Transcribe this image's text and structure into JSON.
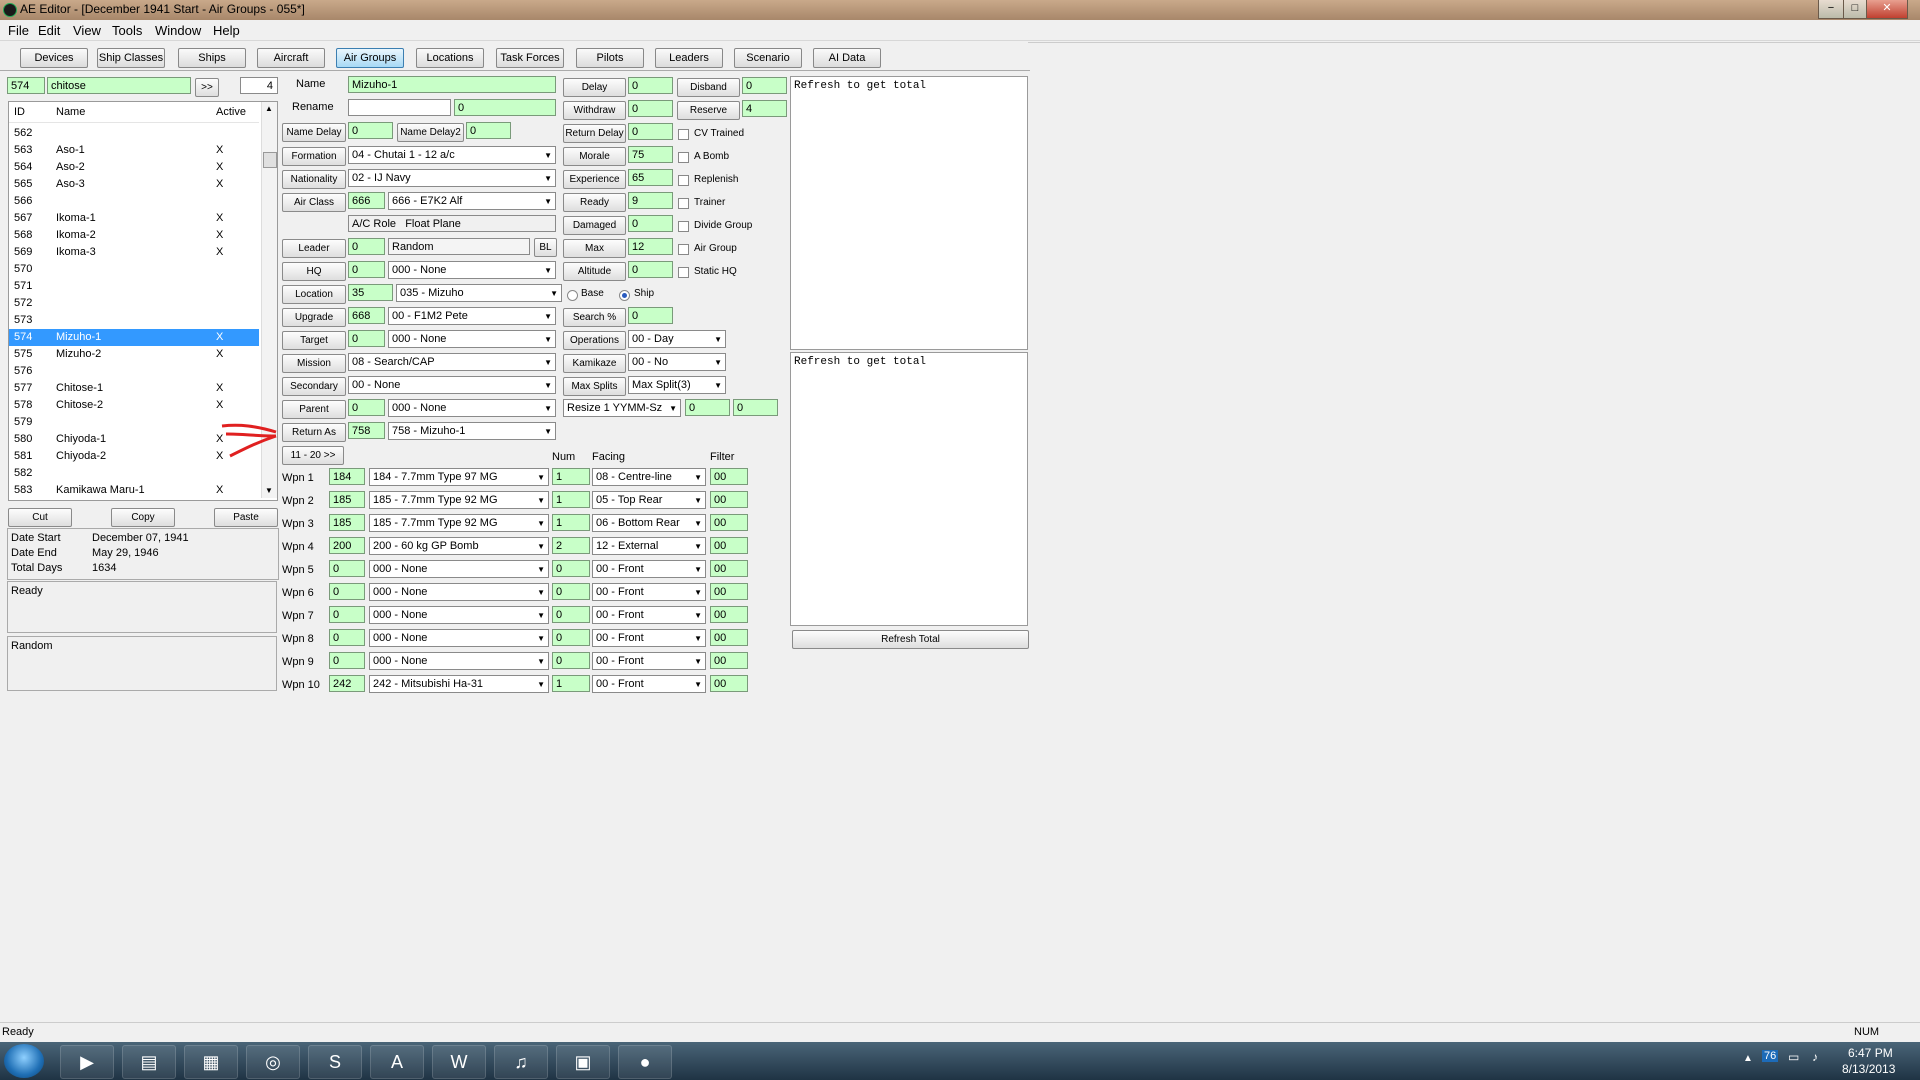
{
  "window": {
    "title": "AE Editor - [December 1941 Start - Air Groups - 055*]",
    "controls": [
      "−",
      "□",
      "✕"
    ]
  },
  "menu": [
    "File",
    "Edit",
    "View",
    "Tools",
    "Window",
    "Help"
  ],
  "tabs": [
    "Devices",
    "Ship Classes",
    "Ships",
    "Aircraft",
    "Air Groups",
    "Locations",
    "Task Forces",
    "Pilots",
    "Leaders",
    "Scenario",
    "AI Data"
  ],
  "search": {
    "id": "574",
    "text": "chitose",
    "go_label": ">>",
    "count": "4"
  },
  "list": {
    "headers": [
      "ID",
      "Name",
      "Active"
    ],
    "rows": [
      {
        "id": "562",
        "name": "",
        "active": ""
      },
      {
        "id": "563",
        "name": "Aso-1",
        "active": "X"
      },
      {
        "id": "564",
        "name": "Aso-2",
        "active": "X"
      },
      {
        "id": "565",
        "name": "Aso-3",
        "active": "X"
      },
      {
        "id": "566",
        "name": "",
        "active": ""
      },
      {
        "id": "567",
        "name": "Ikoma-1",
        "active": "X"
      },
      {
        "id": "568",
        "name": "Ikoma-2",
        "active": "X"
      },
      {
        "id": "569",
        "name": "Ikoma-3",
        "active": "X"
      },
      {
        "id": "570",
        "name": "",
        "active": ""
      },
      {
        "id": "571",
        "name": "",
        "active": ""
      },
      {
        "id": "572",
        "name": "",
        "active": ""
      },
      {
        "id": "573",
        "name": "",
        "active": ""
      },
      {
        "id": "574",
        "name": "Mizuho-1",
        "active": "X"
      },
      {
        "id": "575",
        "name": "Mizuho-2",
        "active": "X"
      },
      {
        "id": "576",
        "name": "",
        "active": ""
      },
      {
        "id": "577",
        "name": "Chitose-1",
        "active": "X"
      },
      {
        "id": "578",
        "name": "Chitose-2",
        "active": "X"
      },
      {
        "id": "579",
        "name": "",
        "active": ""
      },
      {
        "id": "580",
        "name": "Chiyoda-1",
        "active": "X"
      },
      {
        "id": "581",
        "name": "Chiyoda-2",
        "active": "X"
      },
      {
        "id": "582",
        "name": "",
        "active": ""
      },
      {
        "id": "583",
        "name": "Kamikawa Maru-1",
        "active": "X"
      }
    ],
    "selected_id": "574"
  },
  "clipboard": {
    "cut": "Cut",
    "copy": "Copy",
    "paste": "Paste"
  },
  "dates": {
    "start_label": "Date Start",
    "start": "December 07, 1941",
    "end_label": "Date End",
    "end": "May 29, 1946",
    "days_label": "Total Days",
    "days": "1634"
  },
  "status_box": "Ready",
  "leader_box": "Random",
  "form": {
    "name_label": "Name",
    "name": "Mizuho-1",
    "rename_label": "Rename",
    "rename": "",
    "rename_num": "0",
    "name_delay_label": "Name Delay",
    "name_delay": "0",
    "name_delay2_label": "Name Delay2",
    "name_delay2": "0",
    "formation_label": "Formation",
    "formation": "04 - Chutai 1 - 12 a/c",
    "nationality_label": "Nationality",
    "nationality": "02 - IJ Navy",
    "air_class_label": "Air Class",
    "air_class_id": "666",
    "air_class": "666 - E7K2 Alf",
    "ac_role_label": "A/C Role",
    "ac_role": "Float Plane",
    "leader_label": "Leader",
    "leader_id": "0",
    "leader": "Random",
    "bl": "BL",
    "hq_label": "HQ",
    "hq_id": "0",
    "hq": "000 - None",
    "location_label": "Location",
    "location_id": "35",
    "location": "035 - Mizuho",
    "base_label": "Base",
    "ship_label": "Ship",
    "upgrade_label": "Upgrade",
    "upgrade_id": "668",
    "upgrade": "00 - F1M2 Pete",
    "target_label": "Target",
    "target_id": "0",
    "target": "000 - None",
    "mission_label": "Mission",
    "mission": "08 - Search/CAP",
    "secondary_label": "Secondary",
    "secondary": "00 - None",
    "parent_label": "Parent",
    "parent_id": "0",
    "parent": "000 - None",
    "return_as_label": "Return As",
    "return_as_id": "758",
    "return_as": "758 - Mizuho-1",
    "page_btn": "11 - 20 >>"
  },
  "mid": {
    "delay_label": "Delay",
    "delay": "0",
    "withdraw_label": "Withdraw",
    "withdraw": "0",
    "return_delay_label": "Return Delay",
    "return_delay": "0",
    "morale_label": "Morale",
    "morale": "75",
    "experience_label": "Experience",
    "experience": "65",
    "ready_label": "Ready",
    "ready": "9",
    "damaged_label": "Damaged",
    "damaged": "0",
    "max_label": "Max",
    "max": "12",
    "altitude_label": "Altitude",
    "altitude": "0",
    "search_label": "Search %",
    "search": "0",
    "operations_label": "Operations",
    "operations": "00 - Day",
    "kamikaze_label": "Kamikaze",
    "kamikaze": "00 - No",
    "max_splits_label": "Max Splits",
    "max_splits": "Max Split(3)",
    "resize": "Resize 1 YYMM-Sz",
    "resize_a": "0",
    "resize_b": "0"
  },
  "right": {
    "disband_label": "Disband",
    "disband": "0",
    "reserve_label": "Reserve",
    "reserve": "4",
    "checks": [
      "CV Trained",
      "A Bomb",
      "Replenish",
      "Trainer",
      "Divide Group",
      "Air Group",
      "Static HQ"
    ]
  },
  "weapons": {
    "num_header": "Num",
    "facing_header": "Facing",
    "filter_header": "Filter",
    "rows": [
      {
        "label": "Wpn 1",
        "id": "184",
        "name": "184 - 7.7mm Type 97 MG",
        "num": "1",
        "facing": "08 - Centre-line",
        "filter": "00"
      },
      {
        "label": "Wpn 2",
        "id": "185",
        "name": "185 - 7.7mm Type 92 MG",
        "num": "1",
        "facing": "05 - Top Rear",
        "filter": "00"
      },
      {
        "label": "Wpn 3",
        "id": "185",
        "name": "185 - 7.7mm Type 92 MG",
        "num": "1",
        "facing": "06 - Bottom Rear",
        "filter": "00"
      },
      {
        "label": "Wpn 4",
        "id": "200",
        "name": "200 - 60 kg GP Bomb",
        "num": "2",
        "facing": "12 - External",
        "filter": "00"
      },
      {
        "label": "Wpn 5",
        "id": "0",
        "name": "000 - None",
        "num": "0",
        "facing": "00 - Front",
        "filter": "00"
      },
      {
        "label": "Wpn 6",
        "id": "0",
        "name": "000 - None",
        "num": "0",
        "facing": "00 - Front",
        "filter": "00"
      },
      {
        "label": "Wpn 7",
        "id": "0",
        "name": "000 - None",
        "num": "0",
        "facing": "00 - Front",
        "filter": "00"
      },
      {
        "label": "Wpn 8",
        "id": "0",
        "name": "000 - None",
        "num": "0",
        "facing": "00 - Front",
        "filter": "00"
      },
      {
        "label": "Wpn 9",
        "id": "0",
        "name": "000 - None",
        "num": "0",
        "facing": "00 - Front",
        "filter": "00"
      },
      {
        "label": "Wpn 10",
        "id": "242",
        "name": "242 - Mitsubishi Ha-31",
        "num": "1",
        "facing": "00 - Front",
        "filter": "00"
      }
    ]
  },
  "totals": {
    "box1": "Refresh to get total",
    "box2": "Refresh to get total",
    "refresh_btn": "Refresh Total"
  },
  "statusbar": {
    "left": "Ready",
    "right": "NUM"
  },
  "taskbar": {
    "clock_time": "6:47 PM",
    "clock_date": "8/13/2013",
    "tray_num": "76"
  },
  "taskbar_icons": [
    "start-orb-icon",
    "media-player-icon",
    "file-explorer-icon",
    "folder-icon",
    "network-icon",
    "skype-icon",
    "acrobat-icon",
    "word-icon",
    "itunes-icon",
    "witp-ae-icon",
    "ae-editor-icon"
  ],
  "colors": {
    "field_green": "#c8ffc8",
    "selection": "#3399ff",
    "annotation": "#e02020"
  }
}
